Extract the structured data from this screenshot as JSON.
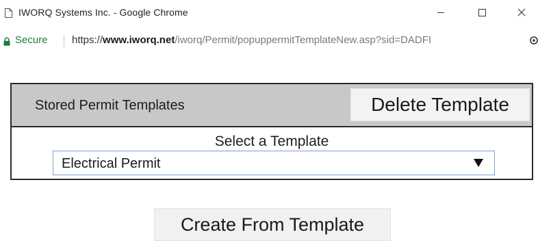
{
  "window": {
    "title": "IWORQ Systems Inc. - Google Chrome",
    "controls": [
      "minimize-icon",
      "maximize-icon",
      "close-icon"
    ]
  },
  "address_bar": {
    "secure_label": "Secure",
    "url_scheme": "https://",
    "url_host": "www.iworq.net",
    "url_path": "/iworq/Permit/popuppermitTemplateNew.asp?sid=DADFI",
    "secure_color": "#1c7c3d"
  },
  "panel": {
    "title": "Stored Permit Templates",
    "delete_label": "Delete Template",
    "select_label": "Select a Template",
    "selected_template": "Electrical Permit",
    "header_color": "#c8c8c8",
    "select_border_color": "#7a9fd6"
  },
  "actions": {
    "create_label": "Create From Template"
  }
}
